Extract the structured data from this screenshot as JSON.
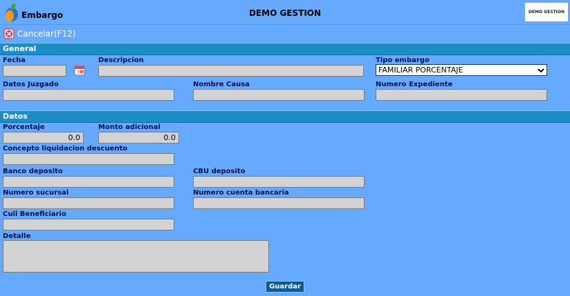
{
  "header": {
    "title": "Embargo",
    "company": "DEMO GESTION",
    "brand_logo_text": "DEMO GESTION"
  },
  "toolbar": {
    "cancel_label": "Cancelar(F12)"
  },
  "sections": {
    "general": "General",
    "datos": "Datos"
  },
  "general": {
    "fecha": {
      "label": "Fecha",
      "value": ""
    },
    "descripcion": {
      "label": "Descripcion",
      "value": ""
    },
    "tipo_embargo": {
      "label": "Tipo embargo",
      "selected": "FAMILIAR PORCENTAJE"
    },
    "datos_juzgado": {
      "label": "Datos Juzgado",
      "value": ""
    },
    "nombre_causa": {
      "label": "Nombre Causa",
      "value": ""
    },
    "numero_expediente": {
      "label": "Numero Expediente",
      "value": ""
    }
  },
  "datos": {
    "porcentaje": {
      "label": "Porcentaje",
      "value": "0.0"
    },
    "monto_adicional": {
      "label": "Monto adicional",
      "value": "0.0"
    },
    "concepto": {
      "label": "Concepto liquidacion descuento",
      "value": ""
    },
    "banco_deposito": {
      "label": "Banco deposito",
      "value": ""
    },
    "cbu_deposito": {
      "label": "CBU deposito",
      "value": ""
    },
    "numero_sucursal": {
      "label": "Numero sucursal",
      "value": ""
    },
    "numero_cuenta": {
      "label": "Numero cuenta bancaria",
      "value": ""
    },
    "cuil_beneficiario": {
      "label": "Cuil Beneficiario",
      "value": ""
    },
    "detalle": {
      "label": "Detalle",
      "value": ""
    }
  },
  "actions": {
    "save_label": "Guardar"
  },
  "colors": {
    "background": "#66aaff",
    "section_bar": "#1b8fc5",
    "input_fill": "#d3d3d3",
    "save_button": "#0e5a92"
  },
  "icons": {
    "app_logo": "app-logo-icon",
    "cancel": "cancel-icon",
    "calendar": "calendar-icon",
    "dropdown": "chevron-down-icon"
  }
}
